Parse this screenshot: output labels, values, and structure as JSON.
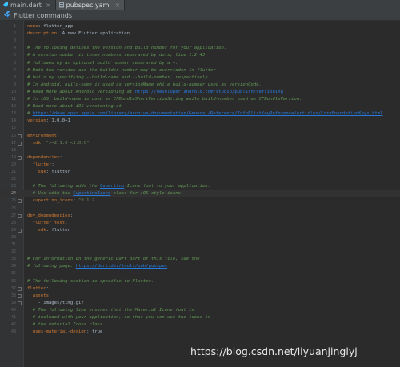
{
  "tabs": [
    {
      "label": "main.dart",
      "icon": "dart-file-icon"
    },
    {
      "label": "pubspec.yaml",
      "icon": "yaml-file-icon",
      "active": true
    }
  ],
  "banner": {
    "label": "Flutter commands",
    "icon": "flutter-icon"
  },
  "current_line": 24,
  "lines": [
    {
      "n": "1",
      "parts": [
        {
          "t": "k",
          "x": "name"
        },
        {
          "t": "v",
          "x": ": flutter_app"
        }
      ]
    },
    {
      "n": "2",
      "parts": [
        {
          "t": "k",
          "x": "description"
        },
        {
          "t": "v",
          "x": ": A new Flutter application."
        }
      ]
    },
    {
      "n": "3",
      "parts": []
    },
    {
      "n": "4",
      "parts": [
        {
          "t": "c",
          "x": "# The following defines the version and build number for your application."
        }
      ]
    },
    {
      "n": "5",
      "parts": [
        {
          "t": "c",
          "x": "# A version number is three numbers separated by dots, like 1.2.43"
        }
      ]
    },
    {
      "n": "6",
      "parts": [
        {
          "t": "c",
          "x": "# followed by an optional build number separated by a +."
        }
      ]
    },
    {
      "n": "7",
      "parts": [
        {
          "t": "c",
          "x": "# Both the version and the builder number may be overridden in flutter"
        }
      ]
    },
    {
      "n": "8",
      "parts": [
        {
          "t": "c",
          "x": "# build by specifying --build-name and --build-number, respectively."
        }
      ]
    },
    {
      "n": "9",
      "parts": [
        {
          "t": "c",
          "x": "# In Android, build-name is used as versionName while build-number used as versionCode."
        }
      ]
    },
    {
      "n": "10",
      "parts": [
        {
          "t": "c",
          "x": "# Read more about Android versioning at "
        },
        {
          "t": "u",
          "x": "https://developer.android.com/studio/publish/versioning"
        }
      ]
    },
    {
      "n": "11",
      "parts": [
        {
          "t": "c",
          "x": "# In iOS, build-name is used as CFBundleShortVersionString while build-number used as CFBundleVersion."
        }
      ]
    },
    {
      "n": "12",
      "parts": [
        {
          "t": "c",
          "x": "# Read more about iOS versioning at"
        }
      ]
    },
    {
      "n": "13",
      "parts": [
        {
          "t": "c",
          "x": "# "
        },
        {
          "t": "u",
          "x": "https://developer.apple.com/library/archive/documentation/General/Reference/InfoPlistKeyReference/Articles/CoreFoundationKeys.html"
        }
      ]
    },
    {
      "n": "14",
      "parts": [
        {
          "t": "k",
          "x": "version"
        },
        {
          "t": "v",
          "x": ": 1.0.0+1"
        }
      ]
    },
    {
      "n": "15",
      "parts": []
    },
    {
      "n": "16",
      "fold": true,
      "parts": [
        {
          "t": "k",
          "x": "environment"
        },
        {
          "t": "v",
          "x": ":"
        }
      ]
    },
    {
      "n": "17",
      "fold": true,
      "parts": [
        {
          "t": "v",
          "x": "  "
        },
        {
          "t": "k",
          "x": "sdk"
        },
        {
          "t": "v",
          "x": ": "
        },
        {
          "t": "s",
          "x": "\">=2.1.0 <3.0.0\""
        }
      ]
    },
    {
      "n": "18",
      "parts": []
    },
    {
      "n": "19",
      "fold": true,
      "parts": [
        {
          "t": "k",
          "x": "dependencies"
        },
        {
          "t": "v",
          "x": ":"
        }
      ]
    },
    {
      "n": "20",
      "parts": [
        {
          "t": "v",
          "x": "  "
        },
        {
          "t": "k",
          "x": "flutter"
        },
        {
          "t": "v",
          "x": ":"
        }
      ]
    },
    {
      "n": "21",
      "parts": [
        {
          "t": "v",
          "x": "    "
        },
        {
          "t": "k",
          "x": "sdk"
        },
        {
          "t": "v",
          "x": ": flutter"
        }
      ]
    },
    {
      "n": "22",
      "parts": []
    },
    {
      "n": "23",
      "parts": [
        {
          "t": "c",
          "x": "  # The following adds the "
        },
        {
          "t": "u",
          "x": "Cupertino"
        },
        {
          "t": "c",
          "x": " Icons font to your application."
        }
      ]
    },
    {
      "n": "24",
      "parts": [
        {
          "t": "c",
          "x": "  # Use with the "
        },
        {
          "t": "u",
          "x": "CupertinoIcons"
        },
        {
          "t": "c",
          "x": " class for iOS style icons."
        }
      ]
    },
    {
      "n": "25",
      "fold": true,
      "parts": [
        {
          "t": "v",
          "x": "  "
        },
        {
          "t": "k",
          "x": "cupertino_icons"
        },
        {
          "t": "v",
          "x": ": "
        },
        {
          "t": "s",
          "x": "^0.1.2"
        }
      ]
    },
    {
      "n": "26",
      "parts": []
    },
    {
      "n": "27",
      "fold": true,
      "parts": [
        {
          "t": "k",
          "x": "dev_dependencies"
        },
        {
          "t": "v",
          "x": ":"
        }
      ]
    },
    {
      "n": "28",
      "parts": [
        {
          "t": "v",
          "x": "  "
        },
        {
          "t": "k",
          "x": "flutter_test"
        },
        {
          "t": "v",
          "x": ":"
        }
      ]
    },
    {
      "n": "29",
      "fold": true,
      "parts": [
        {
          "t": "v",
          "x": "    "
        },
        {
          "t": "k",
          "x": "sdk"
        },
        {
          "t": "v",
          "x": ": flutter"
        }
      ]
    },
    {
      "n": "30",
      "parts": []
    },
    {
      "n": "31",
      "parts": []
    },
    {
      "n": "32",
      "parts": []
    },
    {
      "n": "33",
      "parts": [
        {
          "t": "c",
          "x": "# For information on the generic Dart part of this file, see the"
        }
      ]
    },
    {
      "n": "34",
      "parts": [
        {
          "t": "c",
          "x": "# following page: "
        },
        {
          "t": "u",
          "x": "https://dart.dev/tools/pub/pubspec"
        }
      ]
    },
    {
      "n": "35",
      "parts": []
    },
    {
      "n": "36",
      "parts": [
        {
          "t": "c",
          "x": "# The following section is specific to Flutter."
        }
      ]
    },
    {
      "n": "37",
      "fold": true,
      "parts": [
        {
          "t": "k",
          "x": "flutter"
        },
        {
          "t": "v",
          "x": ":"
        }
      ]
    },
    {
      "n": "38",
      "fold": true,
      "parts": [
        {
          "t": "v",
          "x": "  "
        },
        {
          "t": "k",
          "x": "assets"
        },
        {
          "t": "v",
          "x": ":"
        }
      ]
    },
    {
      "n": "39",
      "fold": true,
      "parts": [
        {
          "t": "v",
          "x": "    - images/timg.gif"
        }
      ]
    },
    {
      "n": "40",
      "parts": [
        {
          "t": "c",
          "x": "  # The following line ensures that the Material Icons font is"
        }
      ]
    },
    {
      "n": "41",
      "parts": [
        {
          "t": "c",
          "x": "  # included with your application, so that you can use the icons in"
        }
      ]
    },
    {
      "n": "42",
      "parts": [
        {
          "t": "c",
          "x": "  # the material Icons class."
        }
      ]
    },
    {
      "n": "43",
      "parts": [
        {
          "t": "v",
          "x": "  "
        },
        {
          "t": "k",
          "x": "uses-material-design"
        },
        {
          "t": "v",
          "x": ": true"
        }
      ]
    }
  ],
  "watermark": "https://blog.csdn.net/liyuanjinglyj",
  "colors": {
    "background": "#2b2b2b",
    "keyword": "#cc7832",
    "comment": "#629755",
    "link": "#287bde",
    "string": "#6a8759",
    "text": "#a9b7c6"
  }
}
